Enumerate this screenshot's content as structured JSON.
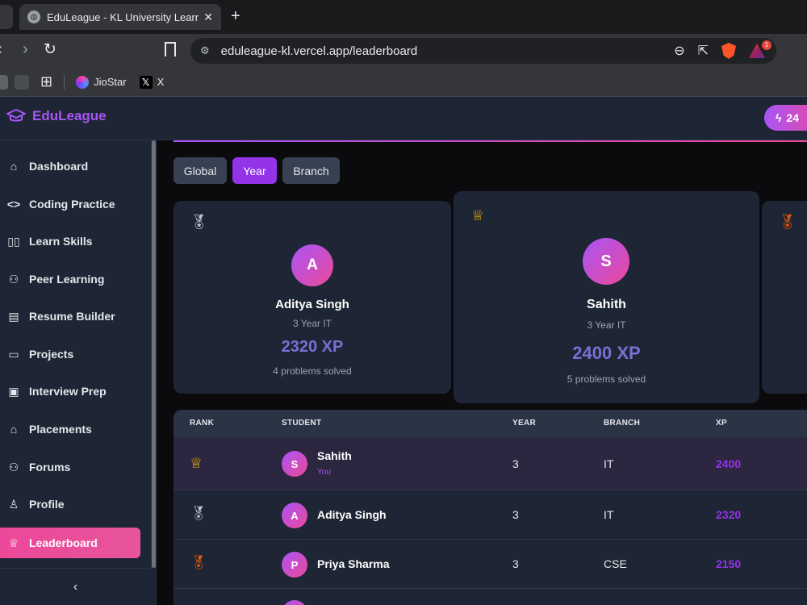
{
  "browser": {
    "tab_title": "EduLeague - KL University Learni",
    "url": "eduleague-kl.vercel.app/leaderboard",
    "notification_count": "1",
    "bookmarks": [
      {
        "label": "JioStar"
      },
      {
        "label": "X"
      }
    ]
  },
  "app": {
    "brand": "EduLeague",
    "xp_badge": "24",
    "accent_colors": [
      "#a855f7",
      "#ec4899"
    ]
  },
  "sidebar": {
    "items": [
      {
        "label": "Dashboard",
        "icon": "home-icon"
      },
      {
        "label": "Coding Practice",
        "icon": "code-icon"
      },
      {
        "label": "Learn Skills",
        "icon": "book-icon"
      },
      {
        "label": "Peer Learning",
        "icon": "users-icon"
      },
      {
        "label": "Resume Builder",
        "icon": "file-icon"
      },
      {
        "label": "Projects",
        "icon": "folder-icon"
      },
      {
        "label": "Interview Prep",
        "icon": "briefcase-icon"
      },
      {
        "label": "Placements",
        "icon": "graduation-cap-icon"
      },
      {
        "label": "Forums",
        "icon": "users-icon"
      },
      {
        "label": "Profile",
        "icon": "user-icon"
      },
      {
        "label": "Leaderboard",
        "icon": "trophy-icon",
        "active": true
      }
    ],
    "collapse_label": "‹"
  },
  "filters": [
    {
      "label": "Global"
    },
    {
      "label": "Year",
      "active": true
    },
    {
      "label": "Branch"
    }
  ],
  "podium": [
    {
      "rank_icon": "silver-medal-icon",
      "initial": "A",
      "name": "Aditya Singh",
      "meta": "3 Year IT",
      "xp": "2320 XP",
      "solved": "4 problems solved"
    },
    {
      "rank_icon": "trophy-icon",
      "initial": "S",
      "name": "Sahith",
      "meta": "3 Year IT",
      "xp": "2400 XP",
      "solved": "5 problems solved"
    },
    {
      "rank_icon": "bronze-medal-icon"
    }
  ],
  "table": {
    "headers": {
      "rank": "RANK",
      "student": "STUDENT",
      "year": "YEAR",
      "branch": "BRANCH",
      "xp": "XP"
    },
    "rows": [
      {
        "rank_icon": "trophy-icon",
        "initial": "S",
        "name": "Sahith",
        "tag": "You",
        "year": "3",
        "branch": "IT",
        "xp": "2400"
      },
      {
        "rank_icon": "silver-medal-icon",
        "initial": "A",
        "name": "Aditya Singh",
        "year": "3",
        "branch": "IT",
        "xp": "2320"
      },
      {
        "rank_icon": "bronze-medal-icon",
        "initial": "P",
        "name": "Priya Sharma",
        "year": "3",
        "branch": "CSE",
        "xp": "2150"
      }
    ]
  }
}
